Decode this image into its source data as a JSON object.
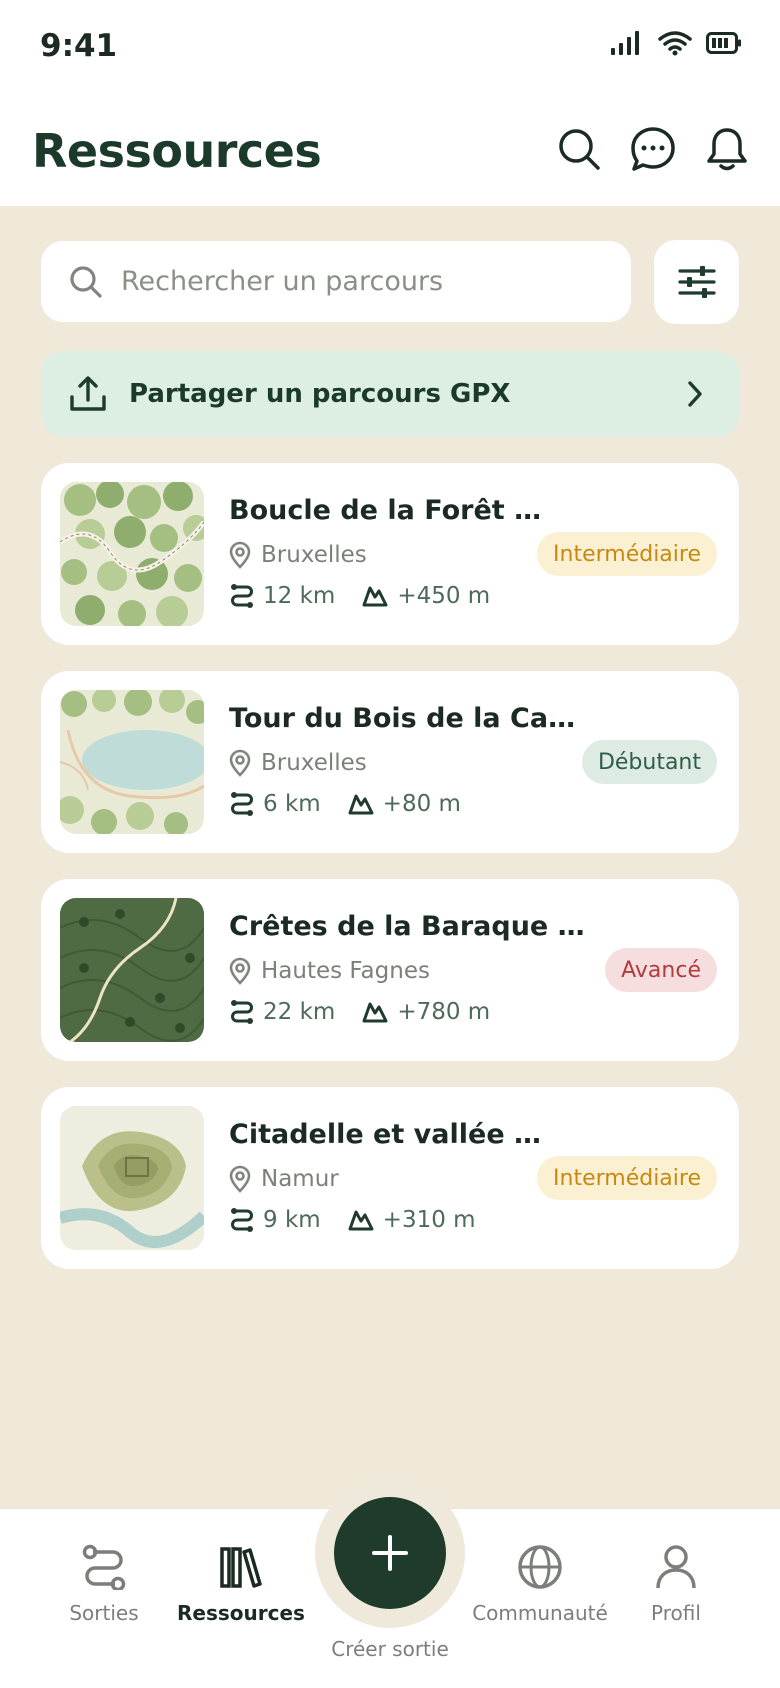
{
  "status": {
    "time": "9:41"
  },
  "header": {
    "title": "Ressources"
  },
  "search": {
    "placeholder": "Rechercher un parcours"
  },
  "gpx": {
    "label": "Partager un parcours GPX"
  },
  "routes": [
    {
      "title": "Boucle de la Forêt de...",
      "location": "Bruxelles",
      "distance": "12 km",
      "elevation": "+450 m",
      "level": "Intermédiaire"
    },
    {
      "title": "Tour du Bois de la Cambre",
      "location": "Bruxelles",
      "distance": "6 km",
      "elevation": "+80 m",
      "level": "Débutant"
    },
    {
      "title": "Crêtes de la Baraque Michel",
      "location": "Hautes Fagnes",
      "distance": "22 km",
      "elevation": "+780 m",
      "level": "Avancé"
    },
    {
      "title": "Citadelle et vallée de...",
      "location": "Namur",
      "distance": "9 km",
      "elevation": "+310 m",
      "level": "Intermédiaire"
    }
  ],
  "tabs": {
    "sorties": "Sorties",
    "ressources": "Ressources",
    "creer": "Créer sortie",
    "communaute": "Communauté",
    "profil": "Profil"
  },
  "colors": {
    "background": "#F0E9DA",
    "primary": "#1E3B2C",
    "gpx_banner": "#DDEEE2",
    "badge_intermediaire": "#C48A13",
    "badge_debutant": "#2E5E45",
    "badge_avance": "#B23B3B"
  },
  "icons": {
    "header": [
      "search-icon",
      "chat-icon",
      "bell-icon"
    ],
    "search": "search-icon",
    "filter": "sliders-icon",
    "gpx": "upload-icon",
    "location": "pin-icon",
    "distance": "route-icon",
    "elevation": "mountain-icon",
    "tabs": [
      "route-icon",
      "library-icon",
      "plus-icon",
      "globe-icon",
      "user-icon"
    ]
  }
}
